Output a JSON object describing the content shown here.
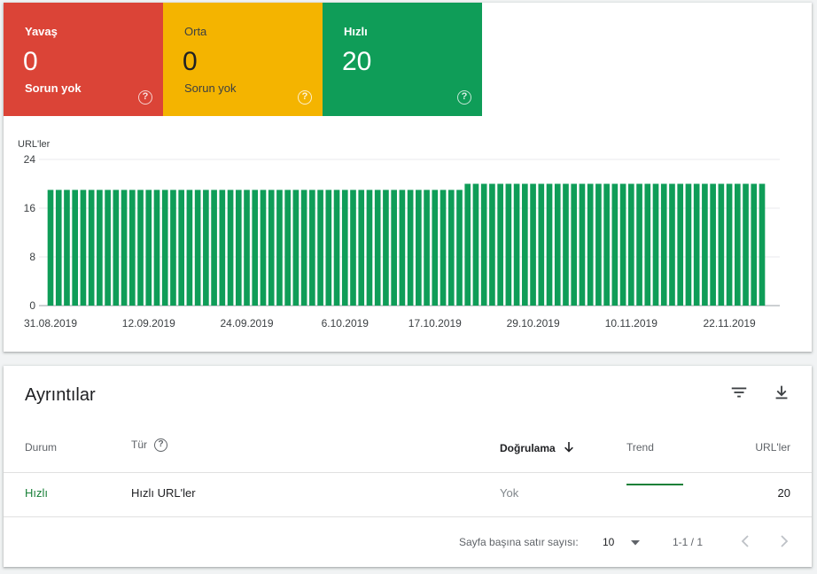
{
  "summary": {
    "slow": {
      "label": "Yavaş",
      "count": "0",
      "sub": "Sorun yok",
      "color": "#db4437"
    },
    "moderate": {
      "label": "Orta",
      "count": "0",
      "sub": "Sorun yok",
      "color": "#f4b400"
    },
    "fast": {
      "label": "Hızlı",
      "count": "20",
      "color": "#0f9d58"
    },
    "help_glyph": "?"
  },
  "chart_data": {
    "type": "bar",
    "ylabel": "URL'ler",
    "yticks": [
      0,
      8,
      16,
      24
    ],
    "ylim": [
      0,
      24
    ],
    "xticks": [
      "31.08.2019",
      "12.09.2019",
      "24.09.2019",
      "6.10.2019",
      "17.10.2019",
      "29.10.2019",
      "10.11.2019",
      "22.11.2019"
    ],
    "x_start": "31.08.2019",
    "x_end": "26.11.2019",
    "segments": [
      {
        "from": "31.08.2019",
        "to": "20.10.2019",
        "value": 19
      },
      {
        "from": "21.10.2019",
        "to": "26.11.2019",
        "value": 20
      }
    ],
    "color": "#0f9d58",
    "grid": true
  },
  "details": {
    "title": "Ayrıntılar",
    "columns": {
      "status": "Durum",
      "type": "Tür",
      "validation": "Doğrulama",
      "trend": "Trend",
      "urls": "URL'ler"
    },
    "rows": [
      {
        "status": "Hızlı",
        "type": "Hızlı URL'ler",
        "validation": "Yok",
        "urls": "20"
      }
    ],
    "footer": {
      "rows_per_page_label": "Sayfa başına satır sayısı:",
      "rows_per_page_value": "10",
      "range": "1-1 / 1"
    },
    "status_color": "#188038"
  }
}
